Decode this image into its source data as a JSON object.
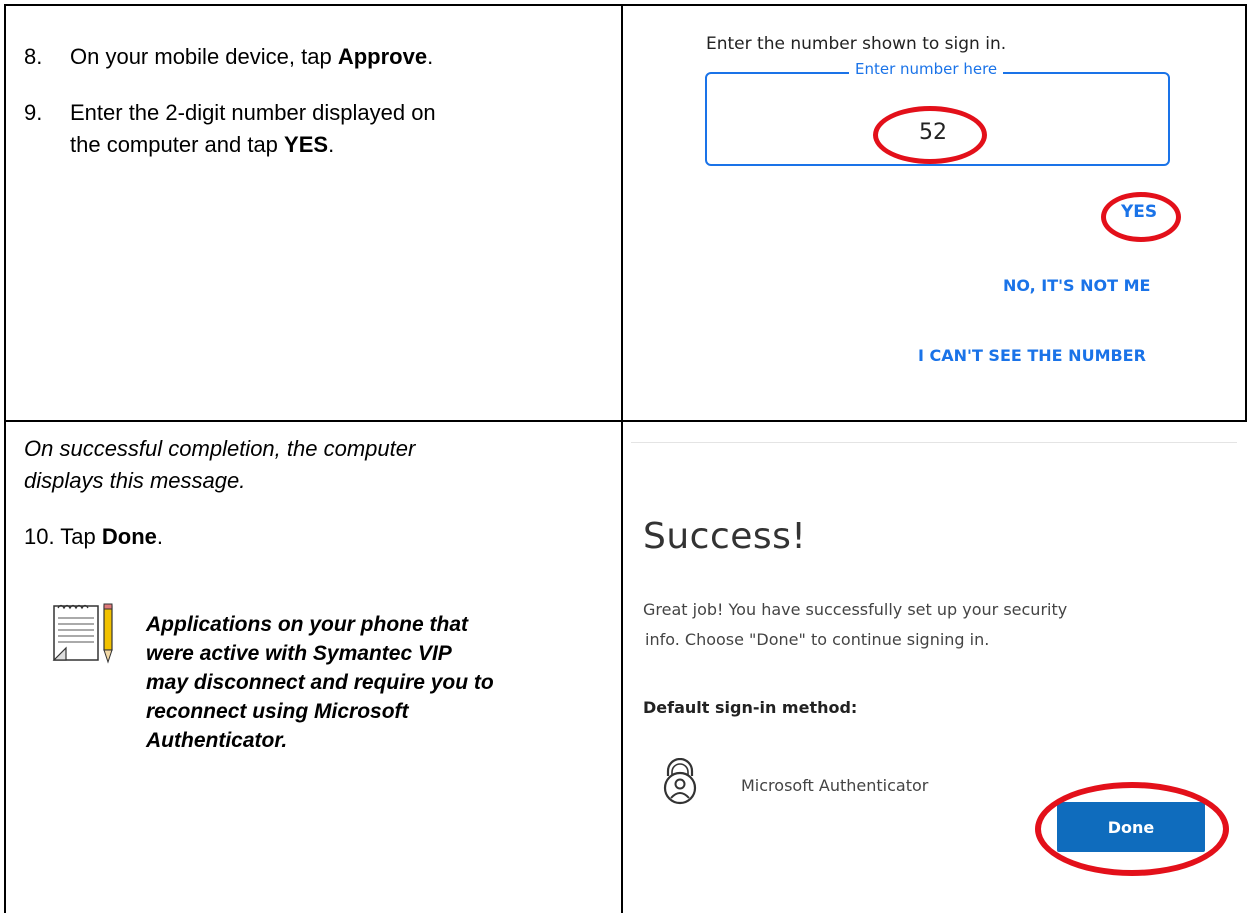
{
  "top_left": {
    "step8": {
      "num": "8.",
      "text_before": "On your mobile device, tap ",
      "bold": "Approve",
      "text_after": "."
    },
    "step9": {
      "num": "9.",
      "line1": "Enter the 2-digit number displayed on",
      "line2_before": "the computer and tap ",
      "bold": "YES",
      "line2_after": "."
    }
  },
  "top_right": {
    "prompt": "Enter the number shown to sign in.",
    "field_legend": "Enter number here",
    "field_value": "52",
    "yes": "YES",
    "not_me": "NO, IT'S NOT ME",
    "cant_see": "I CAN'T SEE THE NUMBER"
  },
  "bottom_left": {
    "intro_line1": "On successful completion, the computer",
    "intro_line2": "displays this message.",
    "step10_prefix": "10. Tap ",
    "step10_bold": "Done",
    "step10_suffix": ".",
    "note_lines": [
      "Applications on your phone that",
      "were active with Symantec VIP",
      "may disconnect and require you to",
      "reconnect using Microsoft",
      "Authenticator."
    ]
  },
  "bottom_right": {
    "heading": "Success!",
    "body_line1": "Great job! You have successfully set up your security",
    "body_line2": "info. Choose \"Done\" to continue signing in.",
    "default_label": "Default sign-in method:",
    "method": "Microsoft Authenticator",
    "done": "Done"
  },
  "icons": [
    "notepad-pencil-icon",
    "authenticator-lock-icon"
  ],
  "colors": {
    "link_blue": "#1a73e8",
    "annotation_red": "#e3101a",
    "done_blue": "#0f6cbd"
  }
}
